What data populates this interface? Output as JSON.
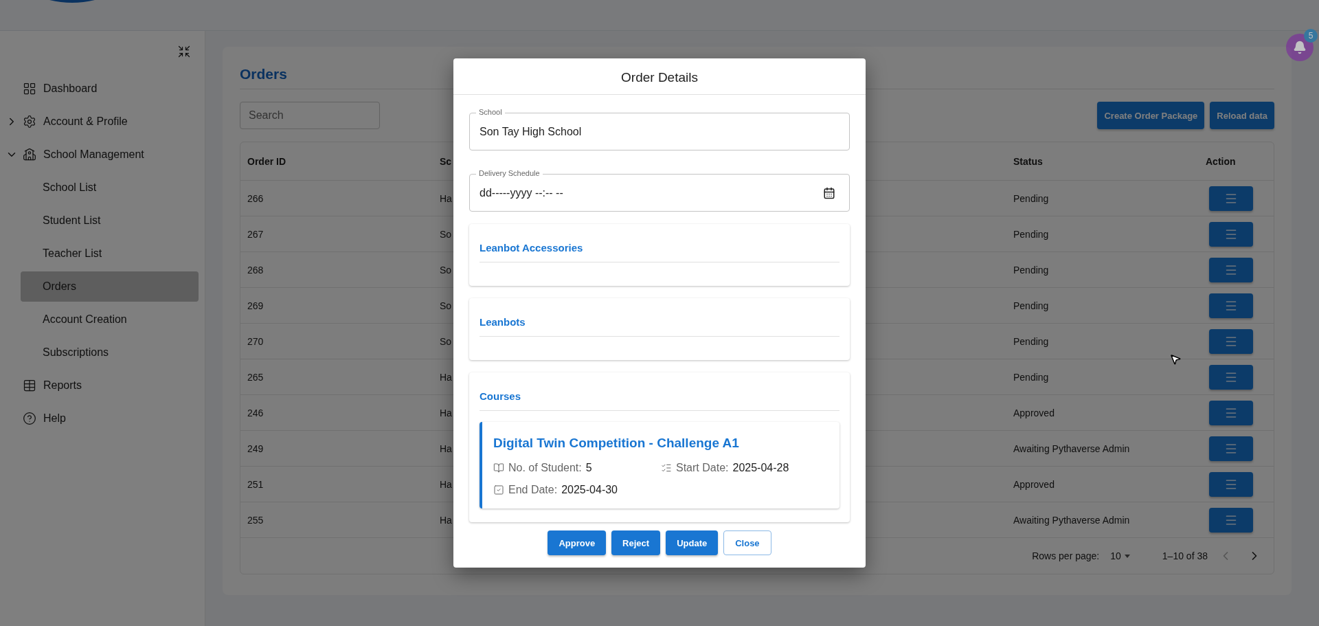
{
  "sidebar": {
    "items": [
      {
        "label": "Dashboard",
        "selected": false
      },
      {
        "label": "Account & Profile",
        "selected": false,
        "expanded": false
      },
      {
        "label": "School Management",
        "selected": false,
        "expanded": true,
        "children": [
          {
            "label": "School List",
            "selected": false
          },
          {
            "label": "Student List",
            "selected": false
          },
          {
            "label": "Teacher List",
            "selected": false
          },
          {
            "label": "Orders",
            "selected": true
          },
          {
            "label": "Account Creation",
            "selected": false
          },
          {
            "label": "Subscriptions",
            "selected": false
          }
        ]
      },
      {
        "label": "Reports",
        "selected": false
      },
      {
        "label": "Help",
        "selected": false
      }
    ]
  },
  "notifications": {
    "count": "5"
  },
  "page": {
    "title": "Orders",
    "search": {
      "placeholder": "Search"
    },
    "buttons": [
      "Create Order Package",
      "Reload data"
    ]
  },
  "table": {
    "columns": [
      "Order ID",
      "Sc",
      "Status",
      "Action"
    ],
    "rows": [
      {
        "order_id": "266",
        "column_2": "Ha",
        "status": "Pending"
      },
      {
        "order_id": "267",
        "column_2": "So",
        "status": "Pending"
      },
      {
        "order_id": "268",
        "column_2": "So",
        "status": "Pending"
      },
      {
        "order_id": "269",
        "column_2": "So",
        "status": "Pending"
      },
      {
        "order_id": "270",
        "column_2": "So",
        "status": "Pending"
      },
      {
        "order_id": "265",
        "column_2": "Ha",
        "status": "Pending"
      },
      {
        "order_id": "246",
        "column_2": "Ha",
        "status": "Approved"
      },
      {
        "order_id": "249",
        "column_2": "Ha",
        "status": "Awaiting Pythaverse Admin"
      },
      {
        "order_id": "251",
        "column_2": "Ha",
        "status": "Approved"
      },
      {
        "order_id": "255",
        "column_2": "Ha",
        "status": "Awaiting Pythaverse Admin"
      }
    ],
    "pagination": {
      "rows_per_page_label": "Rows per page:",
      "rows_per_page": "10",
      "range": "1–10 of 38",
      "prev_disabled": true,
      "next_disabled": false
    }
  },
  "dialog": {
    "title": "Order Details",
    "fields": [
      {
        "label": "School",
        "value": "Son Tay High School",
        "kind": "text"
      },
      {
        "label": "Delivery Schedule",
        "value": "dd-----yyyy --:-- --",
        "kind": "datetime"
      }
    ],
    "sections": [
      {
        "title": "Leanbot Accessories"
      },
      {
        "title": "Leanbots"
      },
      {
        "title": "Courses",
        "courses": [
          {
            "name": "Digital Twin Competition - Challenge A1",
            "details": [
              {
                "label": "No. of Student:",
                "value": "5"
              },
              {
                "label": "Start Date:",
                "value": "2025-04-28"
              },
              {
                "label": "End Date:",
                "value": "2025-04-30"
              }
            ]
          }
        ]
      }
    ],
    "buttons": [
      {
        "label": "Approve",
        "kind": "contained"
      },
      {
        "label": "Reject",
        "kind": "contained"
      },
      {
        "label": "Update",
        "kind": "contained"
      },
      {
        "label": "Close",
        "kind": "outlined"
      }
    ]
  }
}
